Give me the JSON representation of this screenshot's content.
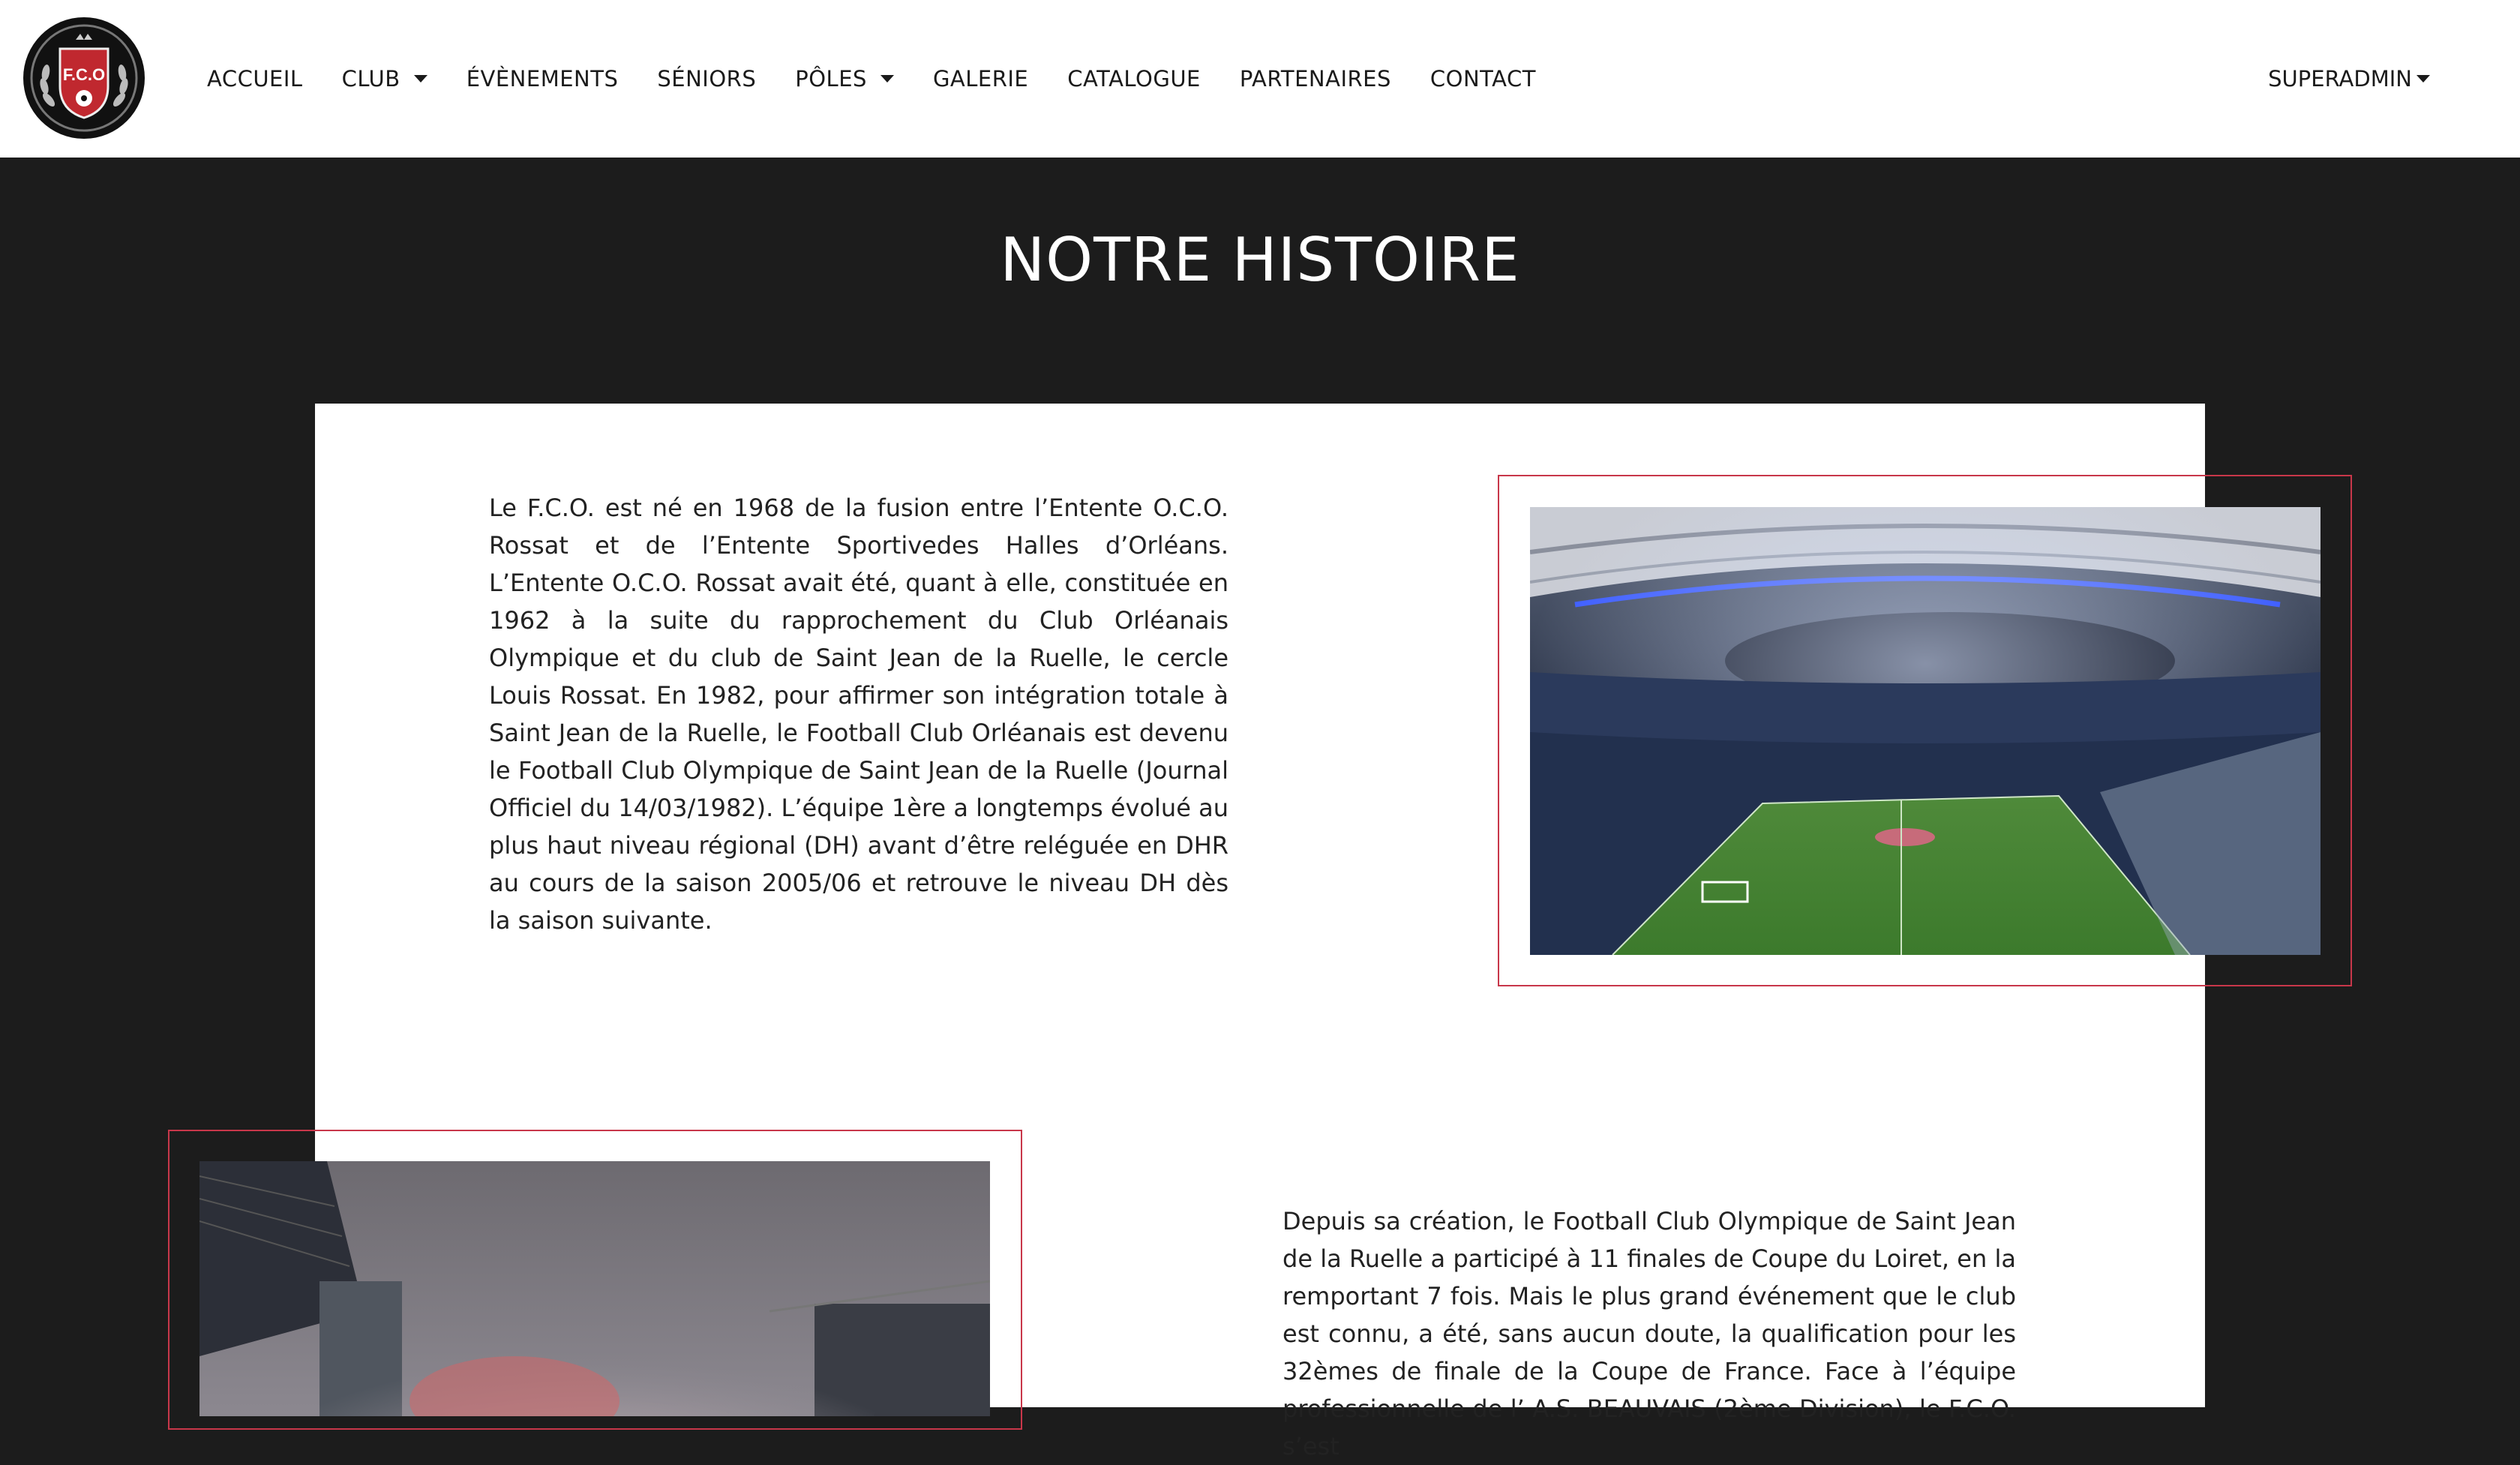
{
  "navbar": {
    "logo_text": "F.C.O",
    "items": [
      {
        "label": "ACCUEIL",
        "has_dropdown": false
      },
      {
        "label": "CLUB",
        "has_dropdown": true
      },
      {
        "label": "ÉVÈNEMENTS",
        "has_dropdown": false
      },
      {
        "label": "SÉNIORS",
        "has_dropdown": false
      },
      {
        "label": "PÔLES",
        "has_dropdown": true
      },
      {
        "label": "GALERIE",
        "has_dropdown": false
      },
      {
        "label": "CATALOGUE",
        "has_dropdown": false
      },
      {
        "label": "PARTENAIRES",
        "has_dropdown": false
      },
      {
        "label": "CONTACT",
        "has_dropdown": false
      }
    ],
    "user_menu_label": "SUPERADMIN"
  },
  "page": {
    "title": "NOTRE HISTOIRE"
  },
  "history": {
    "paragraph_1": "Le F.C.O. est né en 1968 de la fusion entre l’Entente O.C.O. Rossat et de l’Entente Sportivedes Halles d’Orléans. L’Entente O.C.O. Rossat avait été, quant à elle, constituée en 1962 à la suite du rapprochement du Club Orléanais Olympique et du club de Saint Jean de la Ruelle, le cercle Louis Rossat. En 1982, pour affirmer son intégration totale à Saint Jean de la Ruelle, le Football Club Orléanais est devenu le Football Club Olympique de Saint Jean de la Ruelle (Journal Officiel du 14/03/1982). L’équipe 1ère a longtemps évolué au plus haut niveau régional (DH) avant d’être reléguée en DHR au cours de la saison 2005/06 et retrouve le niveau DH dès la saison suivante.",
    "paragraph_2": "Depuis sa création, le Football Club Olympique de Saint Jean de la Ruelle a participé à 11 finales de Coupe du Loiret, en la remportant 7 fois. Mais le plus grand événement que le club est connu, a été, sans aucun doute, la qualification pour les 32èmes de finale de la Coupe de France. Face à l’équipe professionnelle de l’ A.S. BEAUVAIS (2ème Division), le F.C.O. s’est"
  },
  "colors": {
    "accent_frame": "#c8374a",
    "background_dark": "#1c1c1c",
    "navbar_bg": "#ffffff"
  },
  "icons": {
    "dropdown": "caret-down-icon",
    "logo": "club-crest-logo"
  }
}
